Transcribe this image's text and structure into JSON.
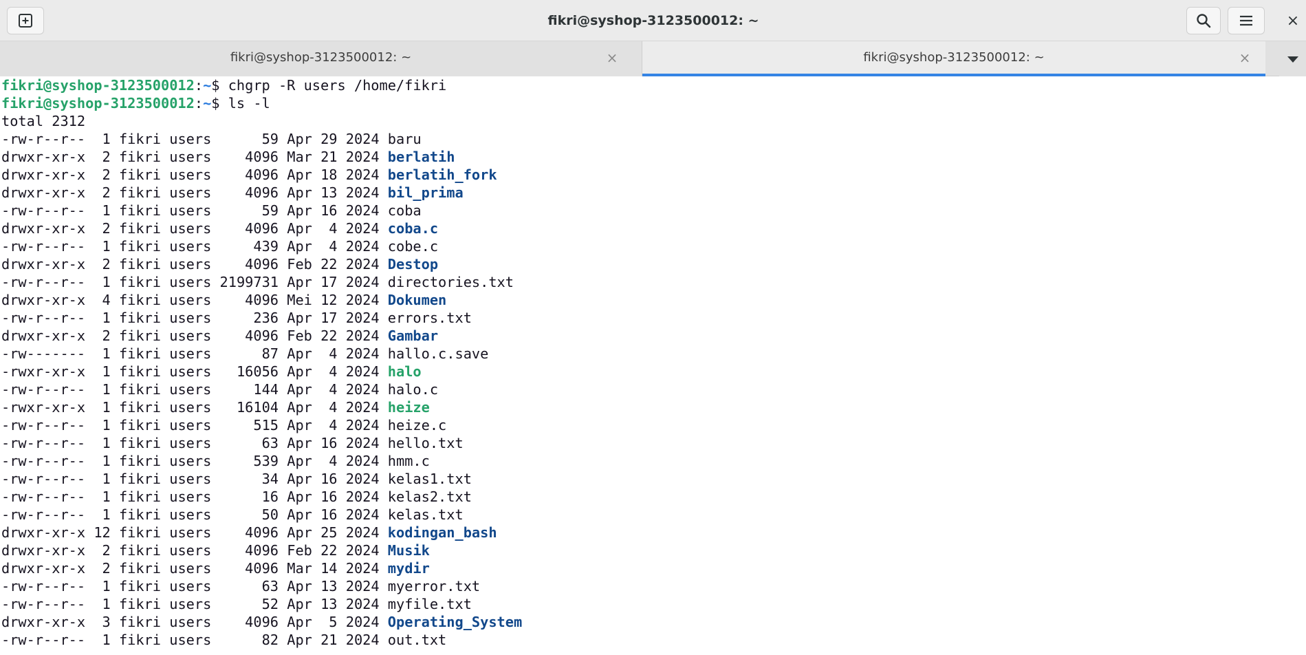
{
  "window": {
    "title": "fikri@syshop-3123500012: ~",
    "close_glyph": "×"
  },
  "icons": {
    "new_tab": "new-tab-icon",
    "search": "search-icon",
    "menu": "hamburger-menu-icon",
    "close": "close-icon",
    "tab_close": "tab-close-icon",
    "dropdown": "chevron-down-icon"
  },
  "tabs": [
    {
      "label": "fikri@syshop-3123500012: ~",
      "close_glyph": "×",
      "active": false
    },
    {
      "label": "fikri@syshop-3123500012: ~",
      "close_glyph": "×",
      "active": true
    }
  ],
  "colors": {
    "prompt_user": "#26a269",
    "prompt_path": "#2a7bde",
    "directory": "#12488b",
    "executable": "#26a269",
    "active_tab_indicator": "#3584e4"
  },
  "terminal": {
    "prompt": {
      "user": "fikri@syshop-3123500012",
      "sep": ":",
      "path": "~",
      "symbol": "$ "
    },
    "commands": [
      "chgrp -R users /home/fikri",
      "ls -l"
    ],
    "total_line": "total 2312",
    "entries": [
      {
        "perms": "-rw-r--r--",
        "links": "1",
        "owner": "fikri",
        "group": "users",
        "size": "59",
        "month": "Apr",
        "day": "29",
        "year": "2024",
        "name": "baru",
        "type": "file"
      },
      {
        "perms": "drwxr-xr-x",
        "links": "2",
        "owner": "fikri",
        "group": "users",
        "size": "4096",
        "month": "Mar",
        "day": "21",
        "year": "2024",
        "name": "berlatih",
        "type": "dir"
      },
      {
        "perms": "drwxr-xr-x",
        "links": "2",
        "owner": "fikri",
        "group": "users",
        "size": "4096",
        "month": "Apr",
        "day": "18",
        "year": "2024",
        "name": "berlatih_fork",
        "type": "dir"
      },
      {
        "perms": "drwxr-xr-x",
        "links": "2",
        "owner": "fikri",
        "group": "users",
        "size": "4096",
        "month": "Apr",
        "day": "13",
        "year": "2024",
        "name": "bil_prima",
        "type": "dir"
      },
      {
        "perms": "-rw-r--r--",
        "links": "1",
        "owner": "fikri",
        "group": "users",
        "size": "59",
        "month": "Apr",
        "day": "16",
        "year": "2024",
        "name": "coba",
        "type": "file"
      },
      {
        "perms": "drwxr-xr-x",
        "links": "2",
        "owner": "fikri",
        "group": "users",
        "size": "4096",
        "month": "Apr",
        "day": "4",
        "year": "2024",
        "name": "coba.c",
        "type": "dir"
      },
      {
        "perms": "-rw-r--r--",
        "links": "1",
        "owner": "fikri",
        "group": "users",
        "size": "439",
        "month": "Apr",
        "day": "4",
        "year": "2024",
        "name": "cobe.c",
        "type": "file"
      },
      {
        "perms": "drwxr-xr-x",
        "links": "2",
        "owner": "fikri",
        "group": "users",
        "size": "4096",
        "month": "Feb",
        "day": "22",
        "year": "2024",
        "name": "Destop",
        "type": "dir"
      },
      {
        "perms": "-rw-r--r--",
        "links": "1",
        "owner": "fikri",
        "group": "users",
        "size": "2199731",
        "month": "Apr",
        "day": "17",
        "year": "2024",
        "name": "directories.txt",
        "type": "file"
      },
      {
        "perms": "drwxr-xr-x",
        "links": "4",
        "owner": "fikri",
        "group": "users",
        "size": "4096",
        "month": "Mei",
        "day": "12",
        "year": "2024",
        "name": "Dokumen",
        "type": "dir"
      },
      {
        "perms": "-rw-r--r--",
        "links": "1",
        "owner": "fikri",
        "group": "users",
        "size": "236",
        "month": "Apr",
        "day": "17",
        "year": "2024",
        "name": "errors.txt",
        "type": "file"
      },
      {
        "perms": "drwxr-xr-x",
        "links": "2",
        "owner": "fikri",
        "group": "users",
        "size": "4096",
        "month": "Feb",
        "day": "22",
        "year": "2024",
        "name": "Gambar",
        "type": "dir"
      },
      {
        "perms": "-rw-------",
        "links": "1",
        "owner": "fikri",
        "group": "users",
        "size": "87",
        "month": "Apr",
        "day": "4",
        "year": "2024",
        "name": "hallo.c.save",
        "type": "file"
      },
      {
        "perms": "-rwxr-xr-x",
        "links": "1",
        "owner": "fikri",
        "group": "users",
        "size": "16056",
        "month": "Apr",
        "day": "4",
        "year": "2024",
        "name": "halo",
        "type": "exec"
      },
      {
        "perms": "-rw-r--r--",
        "links": "1",
        "owner": "fikri",
        "group": "users",
        "size": "144",
        "month": "Apr",
        "day": "4",
        "year": "2024",
        "name": "halo.c",
        "type": "file"
      },
      {
        "perms": "-rwxr-xr-x",
        "links": "1",
        "owner": "fikri",
        "group": "users",
        "size": "16104",
        "month": "Apr",
        "day": "4",
        "year": "2024",
        "name": "heize",
        "type": "exec"
      },
      {
        "perms": "-rw-r--r--",
        "links": "1",
        "owner": "fikri",
        "group": "users",
        "size": "515",
        "month": "Apr",
        "day": "4",
        "year": "2024",
        "name": "heize.c",
        "type": "file"
      },
      {
        "perms": "-rw-r--r--",
        "links": "1",
        "owner": "fikri",
        "group": "users",
        "size": "63",
        "month": "Apr",
        "day": "16",
        "year": "2024",
        "name": "hello.txt",
        "type": "file"
      },
      {
        "perms": "-rw-r--r--",
        "links": "1",
        "owner": "fikri",
        "group": "users",
        "size": "539",
        "month": "Apr",
        "day": "4",
        "year": "2024",
        "name": "hmm.c",
        "type": "file"
      },
      {
        "perms": "-rw-r--r--",
        "links": "1",
        "owner": "fikri",
        "group": "users",
        "size": "34",
        "month": "Apr",
        "day": "16",
        "year": "2024",
        "name": "kelas1.txt",
        "type": "file"
      },
      {
        "perms": "-rw-r--r--",
        "links": "1",
        "owner": "fikri",
        "group": "users",
        "size": "16",
        "month": "Apr",
        "day": "16",
        "year": "2024",
        "name": "kelas2.txt",
        "type": "file"
      },
      {
        "perms": "-rw-r--r--",
        "links": "1",
        "owner": "fikri",
        "group": "users",
        "size": "50",
        "month": "Apr",
        "day": "16",
        "year": "2024",
        "name": "kelas.txt",
        "type": "file"
      },
      {
        "perms": "drwxr-xr-x",
        "links": "12",
        "owner": "fikri",
        "group": "users",
        "size": "4096",
        "month": "Apr",
        "day": "25",
        "year": "2024",
        "name": "kodingan_bash",
        "type": "dir"
      },
      {
        "perms": "drwxr-xr-x",
        "links": "2",
        "owner": "fikri",
        "group": "users",
        "size": "4096",
        "month": "Feb",
        "day": "22",
        "year": "2024",
        "name": "Musik",
        "type": "dir"
      },
      {
        "perms": "drwxr-xr-x",
        "links": "2",
        "owner": "fikri",
        "group": "users",
        "size": "4096",
        "month": "Mar",
        "day": "14",
        "year": "2024",
        "name": "mydir",
        "type": "dir"
      },
      {
        "perms": "-rw-r--r--",
        "links": "1",
        "owner": "fikri",
        "group": "users",
        "size": "63",
        "month": "Apr",
        "day": "13",
        "year": "2024",
        "name": "myerror.txt",
        "type": "file"
      },
      {
        "perms": "-rw-r--r--",
        "links": "1",
        "owner": "fikri",
        "group": "users",
        "size": "52",
        "month": "Apr",
        "day": "13",
        "year": "2024",
        "name": "myfile.txt",
        "type": "file"
      },
      {
        "perms": "drwxr-xr-x",
        "links": "3",
        "owner": "fikri",
        "group": "users",
        "size": "4096",
        "month": "Apr",
        "day": "5",
        "year": "2024",
        "name": "Operating_System",
        "type": "dir"
      },
      {
        "perms": "-rw-r--r--",
        "links": "1",
        "owner": "fikri",
        "group": "users",
        "size": "82",
        "month": "Apr",
        "day": "21",
        "year": "2024",
        "name": "out.txt",
        "type": "file"
      }
    ]
  }
}
